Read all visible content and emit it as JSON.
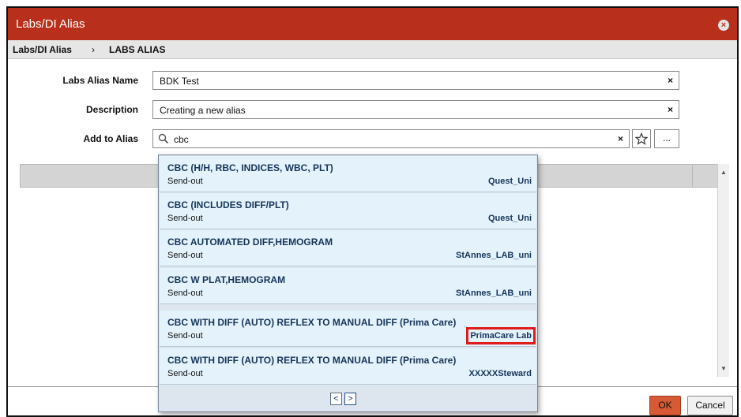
{
  "window": {
    "title": "Labs/DI Alias",
    "close_glyph": "×"
  },
  "breadcrumb": {
    "root": "Labs/DI Alias",
    "separator": "›",
    "current": "LABS ALIAS"
  },
  "form": {
    "alias_name_label": "Labs Alias Name",
    "alias_name_value": "BDK Test",
    "description_label": "Description",
    "description_value": "Creating a new alias",
    "add_to_alias_label": "Add to Alias",
    "add_to_alias_value": "cbc",
    "clear_glyph": "×",
    "search_icon": "search-icon",
    "favorite_icon": "star-icon",
    "more_label": "..."
  },
  "dropdown": {
    "items": [
      {
        "name": "CBC (H/H, RBC, INDICES, WBC, PLT)",
        "type": "Send-out",
        "lab": "Quest_Uni",
        "highlighted": false
      },
      {
        "name": "CBC (INCLUDES DIFF/PLT)",
        "type": "Send-out",
        "lab": "Quest_Uni",
        "highlighted": false
      },
      {
        "name": "CBC AUTOMATED DIFF,HEMOGRAM",
        "type": "Send-out",
        "lab": "StAnnes_LAB_uni",
        "highlighted": false
      },
      {
        "name": "CBC W PLAT,HEMOGRAM",
        "type": "Send-out",
        "lab": "StAnnes_LAB_uni",
        "highlighted": false
      },
      {
        "name": "CBC WITH DIFF (AUTO) REFLEX TO MANUAL DIFF (Prima Care)",
        "type": "Send-out",
        "lab": "PrimaCare Lab",
        "highlighted": true
      },
      {
        "name": "CBC WITH DIFF (AUTO) REFLEX TO MANUAL DIFF (Prima Care)",
        "type": "Send-out",
        "lab": "XXXXXSteward",
        "highlighted": false
      }
    ],
    "pager_prev": "<",
    "pager_next": ">"
  },
  "buttons": {
    "ok": "OK",
    "cancel": "Cancel"
  },
  "colors": {
    "titlebar": "#b8301b",
    "ok_button": "#d65a35",
    "highlight_box": "#e01b1b",
    "dropdown_item": "#e3f2fb"
  }
}
